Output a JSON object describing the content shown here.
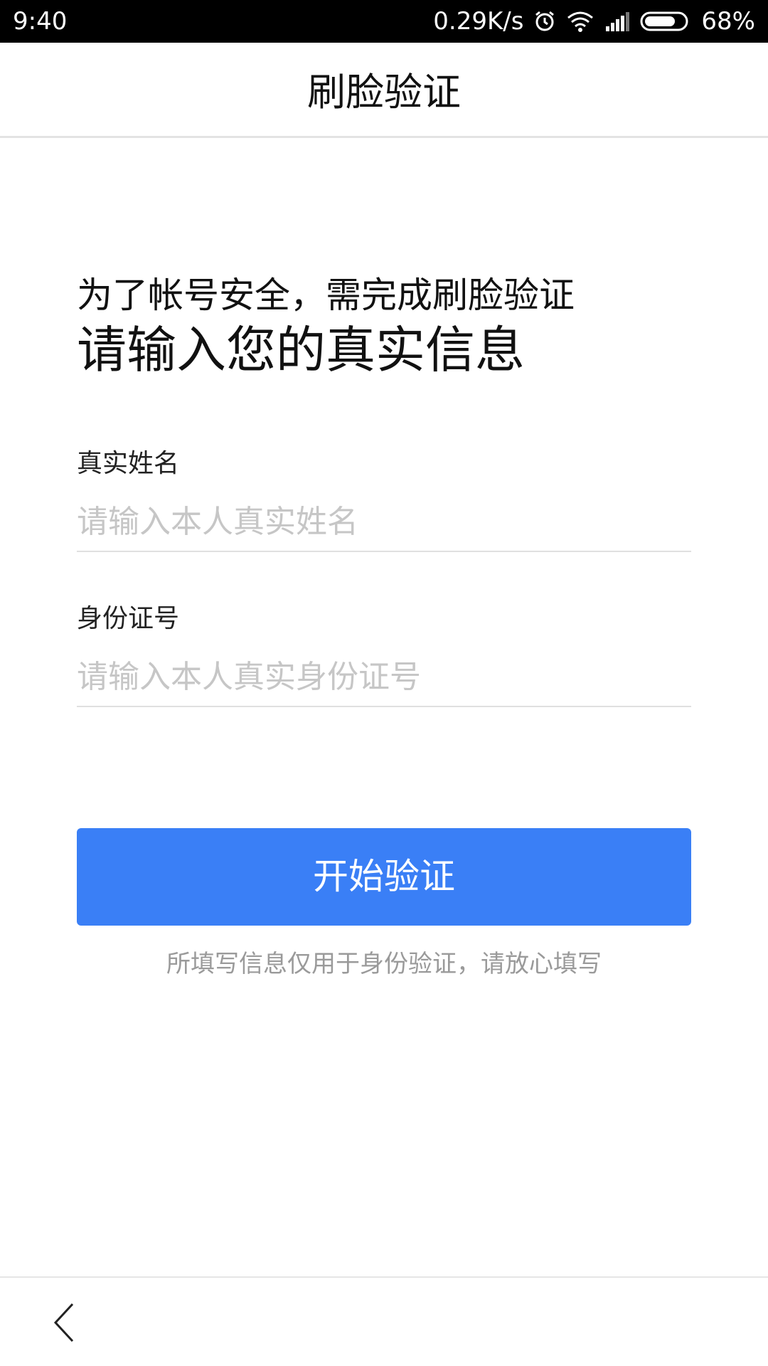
{
  "status_bar": {
    "time": "9:40",
    "network_speed": "0.29K/s",
    "battery": "68%",
    "icons": [
      "alarm-icon",
      "wifi-icon",
      "signal-icon",
      "battery-icon"
    ]
  },
  "header": {
    "title": "刷脸验证"
  },
  "intro": {
    "line1": "为了帐号安全，需完成刷脸验证",
    "line2": "请输入您的真实信息"
  },
  "form": {
    "name_label": "真实姓名",
    "name_placeholder": "请输入本人真实姓名",
    "name_value": "",
    "id_label": "身份证号",
    "id_placeholder": "请输入本人真实身份证号",
    "id_value": ""
  },
  "actions": {
    "start_label": "开始验证",
    "hint": "所填写信息仅用于身份验证，请放心填写"
  },
  "bottom_nav": {
    "back_icon": "chevron-left-icon"
  },
  "colors": {
    "accent": "#3a7ff6",
    "status_bar_bg": "#000000",
    "placeholder": "#c6c6c6",
    "hint": "#9a9a9a"
  }
}
